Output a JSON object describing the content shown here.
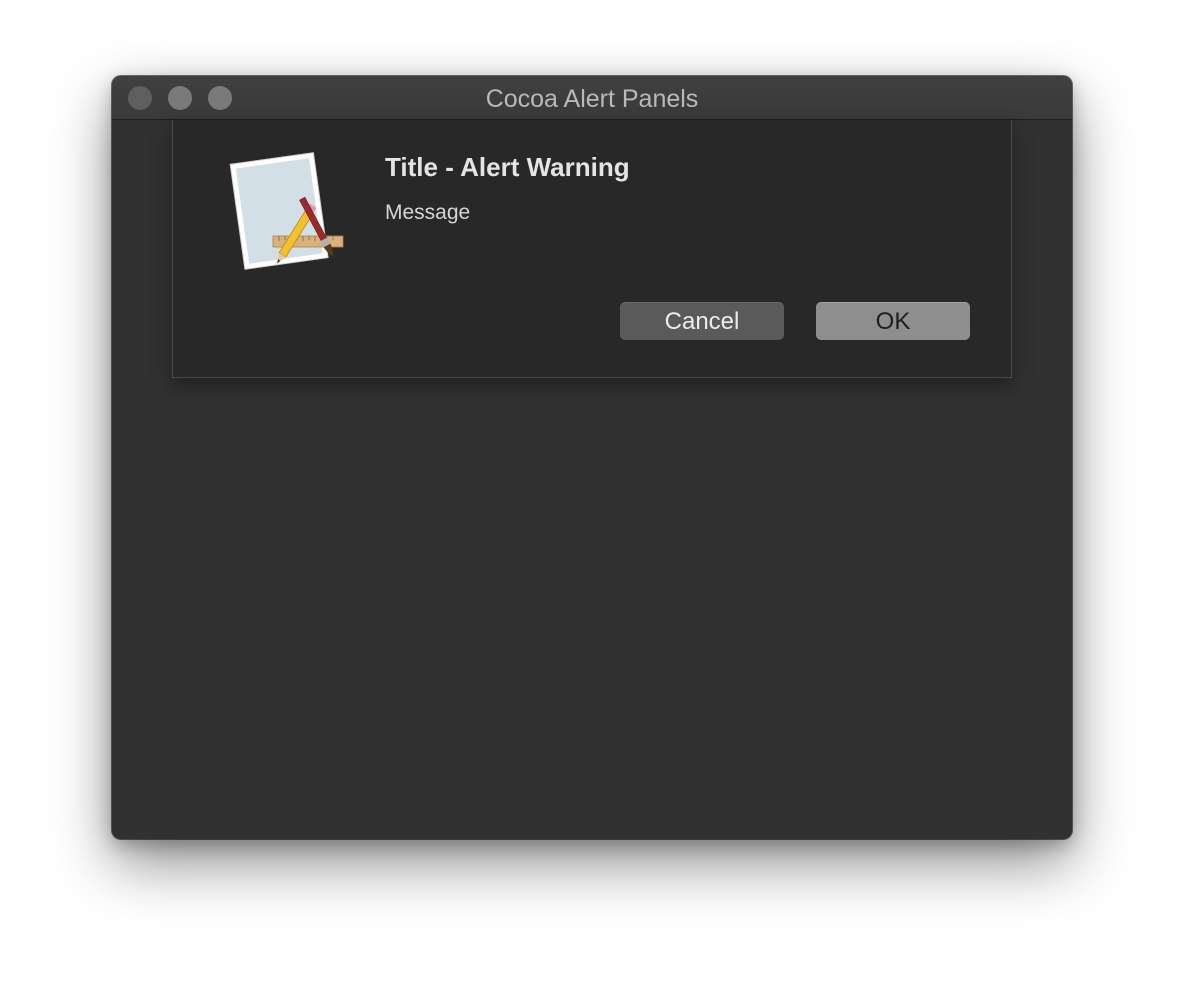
{
  "window": {
    "title": "Cocoa Alert Panels",
    "controls": [
      "close",
      "minimize",
      "zoom"
    ]
  },
  "alert": {
    "icon": "xcode-app-icon",
    "title": "Title - Alert Warning",
    "message": "Message",
    "buttons": {
      "cancel_label": "Cancel",
      "ok_label": "OK"
    }
  },
  "colors": {
    "window_background": "#313131",
    "sheet_background": "#282828",
    "titlebar": "#3d3d3d",
    "cancel_button": "#5a5a5a",
    "default_button": "#8e8e8e"
  }
}
